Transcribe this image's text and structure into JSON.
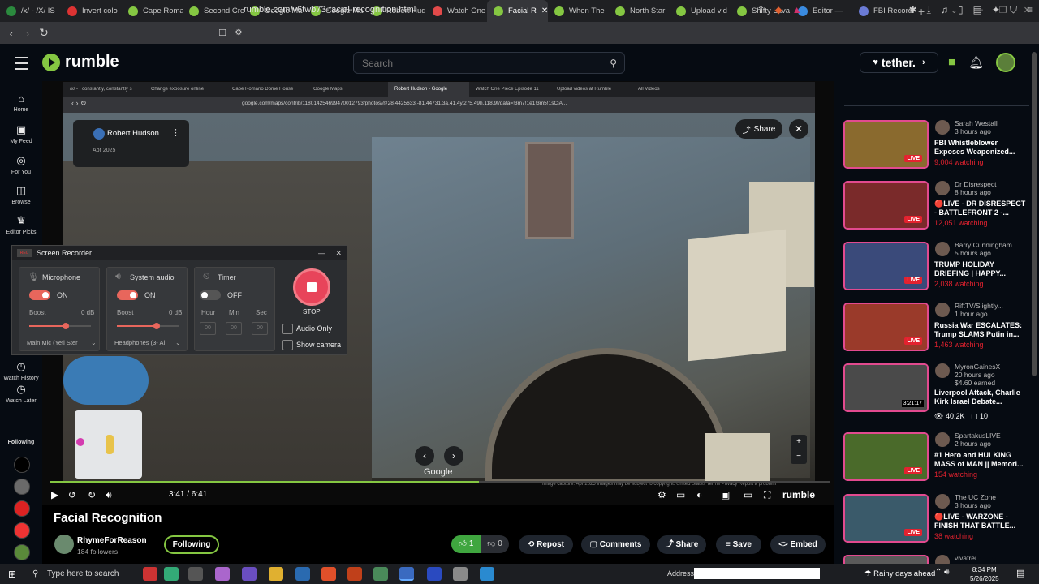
{
  "browser": {
    "tabs": [
      {
        "label": "/x/ - /X/ IS",
        "color": "#2b8a3e"
      },
      {
        "label": "Invert colo",
        "color": "#d33"
      },
      {
        "label": "Cape Romai",
        "color": "#85c742"
      },
      {
        "label": "Second Cre",
        "color": "#85c742"
      },
      {
        "label": "Google Ma",
        "color": "#85c742"
      },
      {
        "label": "Google Ma",
        "color": "#85c742"
      },
      {
        "label": "Robert Hud",
        "color": "#85c742"
      },
      {
        "label": "Watch One",
        "color": "#e24a4a"
      },
      {
        "label": "Facial R",
        "color": "#85c742",
        "active": true
      },
      {
        "label": "When The",
        "color": "#85c742"
      },
      {
        "label": "North Star",
        "color": "#85c742"
      },
      {
        "label": "Upload vid",
        "color": "#85c742"
      },
      {
        "label": "Shifty Lava",
        "color": "#85c742"
      },
      {
        "label": "Editor —",
        "color": "#3a8be0"
      },
      {
        "label": "FBI Record",
        "color": "#6b7bd6"
      }
    ],
    "url": "rumble.com/v6twb73-facial-recognition.html"
  },
  "header": {
    "logo_text": "rumble",
    "search_placeholder": "Search",
    "tether_label": "tether."
  },
  "left_nav": [
    {
      "label": "Home",
      "icon": "home-icon",
      "glyph": "⌂"
    },
    {
      "label": "My Feed",
      "icon": "feed-icon",
      "glyph": "▣"
    },
    {
      "label": "For You",
      "icon": "for-you-icon",
      "glyph": "◎"
    },
    {
      "label": "Browse",
      "icon": "browse-icon",
      "glyph": "◫"
    },
    {
      "label": "Editor Picks",
      "icon": "editor-picks-icon",
      "glyph": "♛"
    },
    {
      "label": "Watch History",
      "icon": "history-icon",
      "glyph": "◷"
    },
    {
      "label": "Watch Later",
      "icon": "watch-later-icon",
      "glyph": "◷"
    }
  ],
  "following_label": "Following",
  "inner_browser": {
    "tabs": [
      "/x/ - I constantly, constantly s",
      "Change exposure online",
      "Cape Romano Dome House",
      "Google Maps",
      "Robert Hudson - Google",
      "Watch One Piece Episode 11",
      "Upload videos at Rumble",
      "All Videos"
    ],
    "url": "google.com/maps/contrib/118014254699470012793/photos/@28.4425633,-81.44731,3a,41.4y,275.49h,118.9t/data=!3m7!1e1!3m5!1sCiA..."
  },
  "streetview": {
    "contributor": "Robert Hudson",
    "date": "Apr 2025",
    "share_label": "Share",
    "watermark": "Google",
    "capture_text": "Image capture: Apr 2025    Images may be subject to copyright.    United States   Terms   Privacy   Report a problem"
  },
  "recorder": {
    "title": "Screen Recorder",
    "microphone": {
      "label": "Microphone",
      "state": "ON",
      "boost_label": "Boost",
      "boost_value": "0 dB",
      "device": "Main Mic (Yeti Ster"
    },
    "system_audio": {
      "label": "System audio",
      "state": "ON",
      "boost_label": "Boost",
      "boost_value": "0 dB",
      "device": "Headphones (3- Ai"
    },
    "timer": {
      "label": "Timer",
      "state": "OFF",
      "hour_label": "Hour",
      "min_label": "Min",
      "sec_label": "Sec",
      "hour": "00",
      "min": "00",
      "sec": "00"
    },
    "stop_label": "STOP",
    "audio_only_label": "Audio Only",
    "show_camera_label": "Show camera"
  },
  "player": {
    "current_time": "3:41 / 6:41",
    "progress": 0.55,
    "brand": "rumble"
  },
  "video": {
    "title": "Facial Recognition",
    "channel": "RhymeForReason",
    "followers": "184 followers",
    "follow_label": "Following",
    "likes": "1",
    "dislikes": "0",
    "repost_label": "Repost",
    "comments_label": "Comments",
    "share_label": "Share",
    "save_label": "Save",
    "embed_label": "Embed"
  },
  "recommendations": [
    {
      "channel": "Sarah Westall",
      "time": "3 hours ago",
      "title": "FBI Whistleblower Exposes Weaponized...",
      "meta": "9,004 watching",
      "live": true,
      "thumb": "#8a6a2e"
    },
    {
      "channel": "Dr Disrespect",
      "time": "8 hours ago",
      "title": "🔴LIVE - DR DISRESPECT - BATTLEFRONT 2 -...",
      "meta": "12,051 watching",
      "live": true,
      "thumb": "#7a2a2a"
    },
    {
      "channel": "Barry Cunningham",
      "time": "5 hours ago",
      "title": "TRUMP HOLIDAY BRIEFING | HAPPY...",
      "meta": "2,038 watching",
      "live": true,
      "thumb": "#3a4a7a"
    },
    {
      "channel": "RiftTV/Slightly...",
      "time": "1 hour ago",
      "title": "Russia War ESCALATES: Trump SLAMS Putin in...",
      "meta": "1,463 watching",
      "live": true,
      "thumb": "#9a3a2a"
    },
    {
      "channel": "MyronGainesX",
      "time": "20 hours ago",
      "earned": "$4.60 earned",
      "title": "Liverpool Attack, Charlie Kirk Israel Debate...",
      "views": "40.2K",
      "comments": "10",
      "duration": "3:21:17",
      "live": false,
      "thumb": "#4a4a4a"
    },
    {
      "channel": "SpartakusLIVE",
      "time": "2 hours ago",
      "title": "#1 Hero and HULKING MASS of MAN || Memori...",
      "meta": "154 watching",
      "live": true,
      "thumb": "#4a6a2a"
    },
    {
      "channel": "The UC Zone",
      "time": "3 hours ago",
      "title": "🔴LIVE - WARZONE - FINISH THAT BATTLE...",
      "meta": "38 watching",
      "live": true,
      "thumb": "#3a5a6a"
    },
    {
      "channel": "vivafrei",
      "time": "",
      "title": "",
      "meta": "",
      "live": false,
      "thumb": "#5a5a5a"
    }
  ],
  "taskbar": {
    "search_placeholder": "Type here to search",
    "address_label": "Address",
    "weather": "Rainy days ahead",
    "time": "8:34 PM",
    "date": "5/26/2025"
  },
  "colors": {
    "accent": "#85c742",
    "live_red": "#e3222f",
    "thumb_border": "#e24a8f"
  }
}
